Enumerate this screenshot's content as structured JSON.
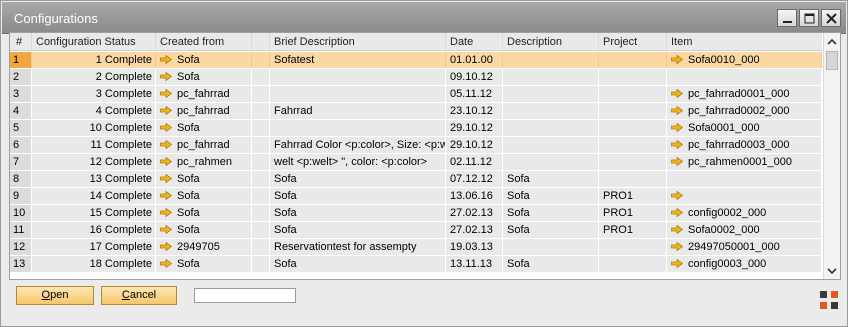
{
  "window": {
    "title": "Configurations",
    "controls": {
      "minimize": "minimize",
      "maximize": "maximize",
      "close": "close"
    }
  },
  "grid": {
    "columns": {
      "num": "#",
      "status": "Configuration Status",
      "created_from": "Created from",
      "brief": "Brief Description",
      "date": "Date",
      "description": "Description",
      "project": "Project",
      "item": "Item"
    },
    "selected_row": 0,
    "rows": [
      {
        "num": "1",
        "status": "1 Complete",
        "created_from": "Sofa",
        "brief": "Sofatest",
        "date": "01.01.00",
        "description": "",
        "project": "",
        "item": "Sofa0010_000"
      },
      {
        "num": "2",
        "status": "2 Complete",
        "created_from": "Sofa",
        "brief": "",
        "date": "09.10.12",
        "description": "",
        "project": "",
        "item": ""
      },
      {
        "num": "3",
        "status": "3 Complete",
        "created_from": "pc_fahrrad",
        "brief": "",
        "date": "05.11.12",
        "description": "",
        "project": "",
        "item": "pc_fahrrad0001_000"
      },
      {
        "num": "4",
        "status": "4 Complete",
        "created_from": "pc_fahrrad",
        "brief": "Fahrrad",
        "date": "23.10.12",
        "description": "",
        "project": "",
        "item": "pc_fahrrad0002_000"
      },
      {
        "num": "5",
        "status": "10 Complete",
        "created_from": "Sofa",
        "brief": "",
        "date": "29.10.12",
        "description": "",
        "project": "",
        "item": "Sofa0001_000"
      },
      {
        "num": "6",
        "status": "11 Complete",
        "created_from": "pc_fahrrad",
        "brief": "Fahrrad Color <p:color>, Size: <p:wh",
        "date": "29.10.12",
        "description": "",
        "project": "",
        "item": "pc_fahrrad0003_000"
      },
      {
        "num": "7",
        "status": "12 Complete",
        "created_from": "pc_rahmen",
        "brief": "welt <p:welt> \", color: <p:color>",
        "date": "02.11.12",
        "description": "",
        "project": "",
        "item": "pc_rahmen0001_000"
      },
      {
        "num": "8",
        "status": "13 Complete",
        "created_from": "Sofa",
        "brief": "Sofa",
        "date": "07.12.12",
        "description": "Sofa",
        "project": "",
        "item": ""
      },
      {
        "num": "9",
        "status": "14 Complete",
        "created_from": "Sofa",
        "brief": "Sofa",
        "date": "13.06.16",
        "description": "Sofa",
        "project": "PRO1",
        "item": ""
      },
      {
        "num": "10",
        "status": "15 Complete",
        "created_from": "Sofa",
        "brief": "Sofa",
        "date": "27.02.13",
        "description": "Sofa",
        "project": "PRO1",
        "item": "config0002_000"
      },
      {
        "num": "11",
        "status": "16 Complete",
        "created_from": "Sofa",
        "brief": "Sofa",
        "date": "27.02.13",
        "description": "Sofa",
        "project": "PRO1",
        "item": "Sofa0002_000"
      },
      {
        "num": "12",
        "status": "17 Complete",
        "created_from": "2949705",
        "brief": "Reservationtest for assempty",
        "date": "19.03.13",
        "description": "",
        "project": "",
        "item": "29497050001_000"
      },
      {
        "num": "13",
        "status": "18 Complete",
        "created_from": "Sofa",
        "brief": "Sofa",
        "date": "13.11.13",
        "description": "Sofa",
        "project": "",
        "item": "config0003_000"
      }
    ],
    "item_arrow_rows": [
      0,
      2,
      3,
      4,
      5,
      6,
      8,
      9,
      10,
      11,
      12
    ]
  },
  "footer": {
    "open_label": "Open",
    "open_mnemonic": "O",
    "cancel_label": "Cancel",
    "cancel_mnemonic": "C",
    "search_value": ""
  },
  "icons": {
    "link_arrow": "link-arrow-icon",
    "corner": "resize-grip-icon"
  },
  "colors": {
    "title_bar": "#9a9a9a",
    "selected_row": "#fbd7a3",
    "selected_row_num": "#f1a63f",
    "link_arrow": "#f2b619",
    "button": "#f8d489"
  }
}
